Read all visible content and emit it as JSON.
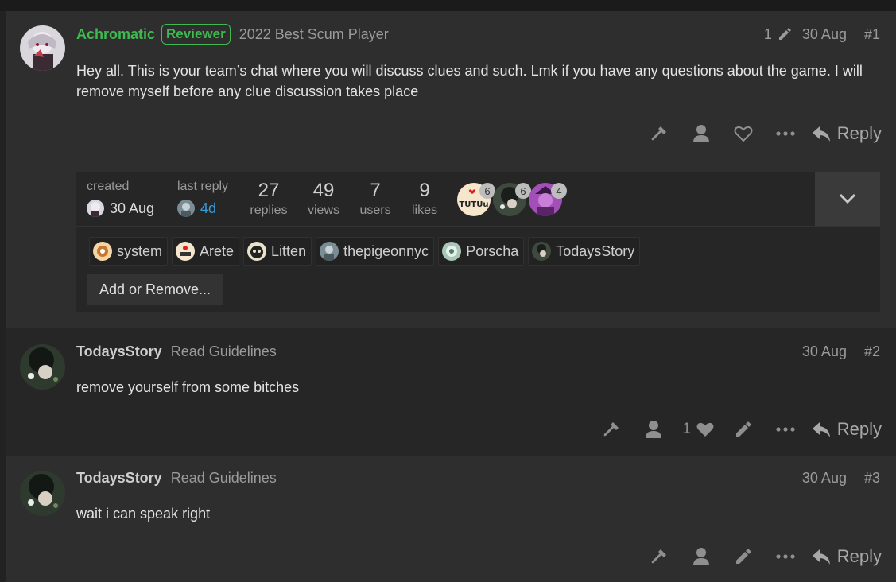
{
  "posts": [
    {
      "username": "Achromatic",
      "flair": "Reviewer",
      "user_title": "2022 Best Scum Player",
      "edits": "1",
      "date": "30 Aug",
      "number": "#1",
      "body": "Hey all. This is your team’s chat where you will discuss clues and such. Lmk if you have any questions about the game. I will remove myself before any clue discussion takes place",
      "reply_label": "Reply"
    },
    {
      "username": "TodaysStory",
      "user_title": "Read Guidelines",
      "date": "30 Aug",
      "number": "#2",
      "body": "remove yourself from some bitches",
      "likes": "1",
      "reply_label": "Reply"
    },
    {
      "username": "TodaysStory",
      "user_title": "Read Guidelines",
      "date": "30 Aug",
      "number": "#3",
      "body": "wait i can speak right",
      "reply_label": "Reply"
    }
  ],
  "topic_map": {
    "created_label": "created",
    "created_date": "30 Aug",
    "last_reply_label": "last reply",
    "last_reply_date": "4d",
    "stats": [
      {
        "value": "27",
        "label": "replies"
      },
      {
        "value": "49",
        "label": "views"
      },
      {
        "value": "7",
        "label": "users"
      },
      {
        "value": "9",
        "label": "likes"
      }
    ],
    "participants": [
      {
        "count": "6"
      },
      {
        "count": "6"
      },
      {
        "count": "4"
      }
    ],
    "allowed_users": [
      "system",
      "Arete",
      "Litten",
      "thepigeonnyc",
      "Porscha",
      "TodaysStory"
    ],
    "add_remove_label": "Add or Remove...",
    "avatar_text_tutu": "TUTUu"
  },
  "colors": {
    "background": "#222222",
    "post_bg": "#2e2e2e",
    "username_green": "#3fb950",
    "link_blue": "#3a9bd9"
  },
  "icons": [
    "pencil-icon",
    "wrench-icon",
    "user-icon",
    "heart-icon",
    "ellipsis-icon",
    "reply-icon",
    "chevron-down-icon"
  ]
}
